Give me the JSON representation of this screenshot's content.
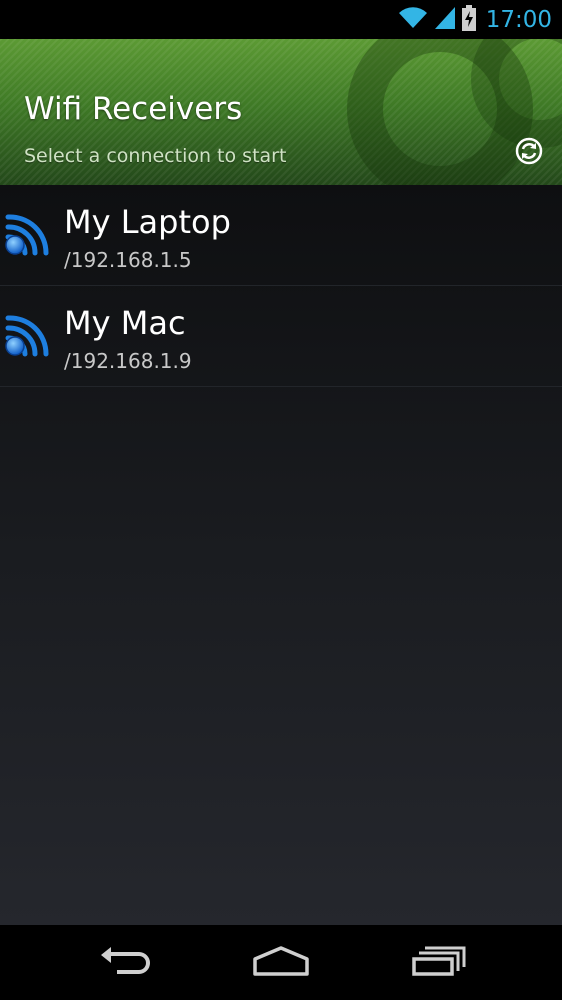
{
  "status_bar": {
    "time": "17:00",
    "icons": [
      "wifi-signal-icon",
      "cell-signal-icon",
      "battery-charging-icon"
    ]
  },
  "header": {
    "title": "Wifi Receivers",
    "subtitle": "Select a connection to start",
    "refresh_icon": "refresh-icon"
  },
  "receivers": [
    {
      "name": "My Laptop",
      "address": "/192.168.1.5",
      "icon": "wifi-receiver-icon"
    },
    {
      "name": "My Mac",
      "address": "/192.168.1.9",
      "icon": "wifi-receiver-icon"
    }
  ],
  "nav_bar": {
    "buttons": [
      "back-icon",
      "home-icon",
      "recent-apps-icon"
    ]
  },
  "colors": {
    "accent": "#33b5e5",
    "header_green": "#3f7a26",
    "wifi_blue": "#1e7fe0"
  }
}
